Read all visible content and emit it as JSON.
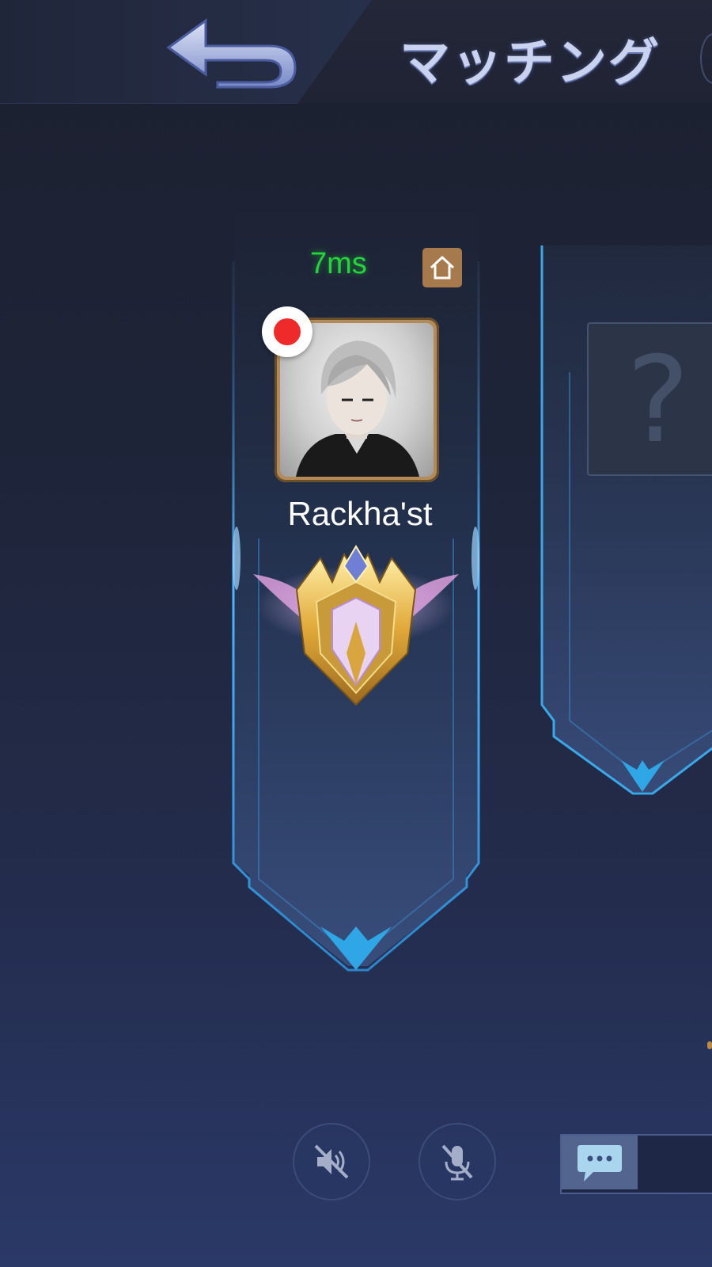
{
  "header": {
    "title": "マッチング",
    "back_icon": "back-arrow-icon"
  },
  "player_slot": {
    "ping": "7ms",
    "ping_color": "#23d43a",
    "home_icon": "home-icon",
    "recording_indicator": "record-dot-icon",
    "player_name": "Rackha'st",
    "rank_icon": "mythic-rank-emblem-icon"
  },
  "empty_slot": {
    "placeholder": "?"
  },
  "controls": {
    "speaker_icon": "speaker-muted-icon",
    "mic_icon": "microphone-muted-icon",
    "chat_icon": "chat-bubble-icon"
  },
  "colors": {
    "frame_glow": "#3aa8e8",
    "avatar_border": "#b38b5a",
    "record": "#ee2a2a"
  }
}
